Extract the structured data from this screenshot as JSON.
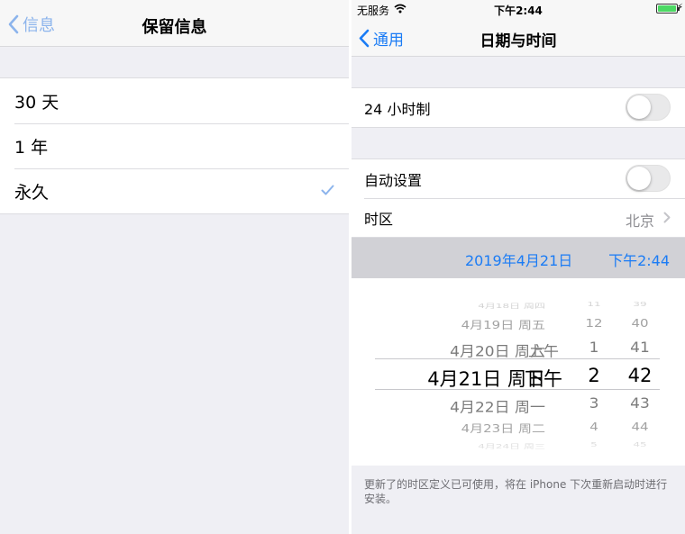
{
  "left": {
    "nav": {
      "back_label": "信息",
      "title": "保留信息"
    },
    "options": [
      {
        "label": "30 天",
        "checked": false
      },
      {
        "label": "1 年",
        "checked": false
      },
      {
        "label": "永久",
        "checked": true
      }
    ]
  },
  "right": {
    "status": {
      "carrier": "无服务",
      "time": "下午2:44",
      "battery_level": 1.0
    },
    "nav": {
      "back_label": "通用",
      "title": "日期与时间"
    },
    "rows": {
      "h24": {
        "label": "24 小时制",
        "on": false
      },
      "auto": {
        "label": "自动设置",
        "on": false
      },
      "timezone": {
        "label": "时区",
        "value": "北京"
      }
    },
    "date_bar": {
      "date": "2019年4月21日",
      "time": "下午2:44"
    },
    "picker": {
      "columns": {
        "date": [
          "4月18日 周四",
          "4月19日 周五",
          "4月20日 周六",
          "4月21日 周日",
          "4月22日 周一",
          "4月23日 周二",
          "4月24日 周三"
        ],
        "ampm": [
          "上午",
          "下午"
        ],
        "hour": [
          "11",
          "12",
          "1",
          "2",
          "3",
          "4",
          "5"
        ],
        "minute": [
          "39",
          "40",
          "41",
          "42",
          "43",
          "44",
          "45"
        ]
      },
      "selected": {
        "date": "4月21日 周日",
        "ampm": "下午",
        "hour": "2",
        "minute": "42"
      }
    },
    "footer_note": "更新了的时区定义已可使用，将在 iPhone 下次重新启动时进行安装。"
  },
  "colors": {
    "tint": "#1b7cf5",
    "tint_light": "#8cb4ec",
    "group_bg": "#efeff4",
    "secondary": "#8e8e93",
    "toggle_off": "#e9e9ea"
  },
  "icons": {
    "back": "chevron-left-icon",
    "check": "checkmark-icon",
    "disclosure": "chevron-right-icon",
    "wifi": "wifi-icon",
    "battery": "battery-icon",
    "charging": "charging-bolt-icon"
  }
}
